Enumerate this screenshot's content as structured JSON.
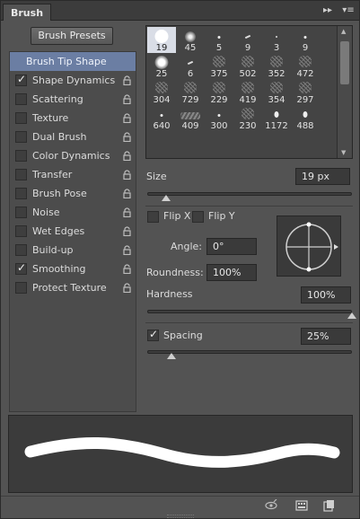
{
  "header": {
    "tab": "Brush",
    "collapse_glyph": "▸▸",
    "menu_glyph": "▾≡"
  },
  "presets_button": "Brush Presets",
  "left_list": {
    "tip_shape": "Brush Tip Shape",
    "options": [
      {
        "label": "Shape Dynamics",
        "checked": true
      },
      {
        "label": "Scattering",
        "checked": false
      },
      {
        "label": "Texture",
        "checked": false
      },
      {
        "label": "Dual Brush",
        "checked": false
      },
      {
        "label": "Color Dynamics",
        "checked": false
      },
      {
        "label": "Transfer",
        "checked": false
      },
      {
        "label": "Brush Pose",
        "checked": false
      },
      {
        "label": "Noise",
        "checked": false
      },
      {
        "label": "Wet Edges",
        "checked": false
      },
      {
        "label": "Build-up",
        "checked": false
      },
      {
        "label": "Smoothing",
        "checked": true
      },
      {
        "label": "Protect Texture",
        "checked": false
      }
    ]
  },
  "brush_grid": {
    "selected_index": 0,
    "rows": [
      [
        "19",
        "45",
        "5",
        "9",
        "3",
        "9"
      ],
      [
        "25",
        "6",
        "375",
        "502",
        "352",
        "472"
      ],
      [
        "304",
        "729",
        "229",
        "419",
        "354",
        "297"
      ],
      [
        "640",
        "409",
        "300",
        "230",
        "1172",
        "488"
      ]
    ]
  },
  "size": {
    "label": "Size",
    "value": "19 px",
    "fraction": 0.09
  },
  "flip_x": {
    "label": "Flip X",
    "checked": false
  },
  "flip_y": {
    "label": "Flip Y",
    "checked": false
  },
  "angle": {
    "label": "Angle:",
    "value": "0°"
  },
  "roundness": {
    "label": "Roundness:",
    "value": "100%"
  },
  "hardness": {
    "label": "Hardness",
    "value": "100%",
    "fraction": 1.0
  },
  "spacing": {
    "label": "Spacing",
    "value": "25%",
    "checked": true,
    "fraction": 0.12
  },
  "colors": {
    "selection": "#6b7ea3",
    "panel": "#535353",
    "stroke": "#ffffff"
  }
}
